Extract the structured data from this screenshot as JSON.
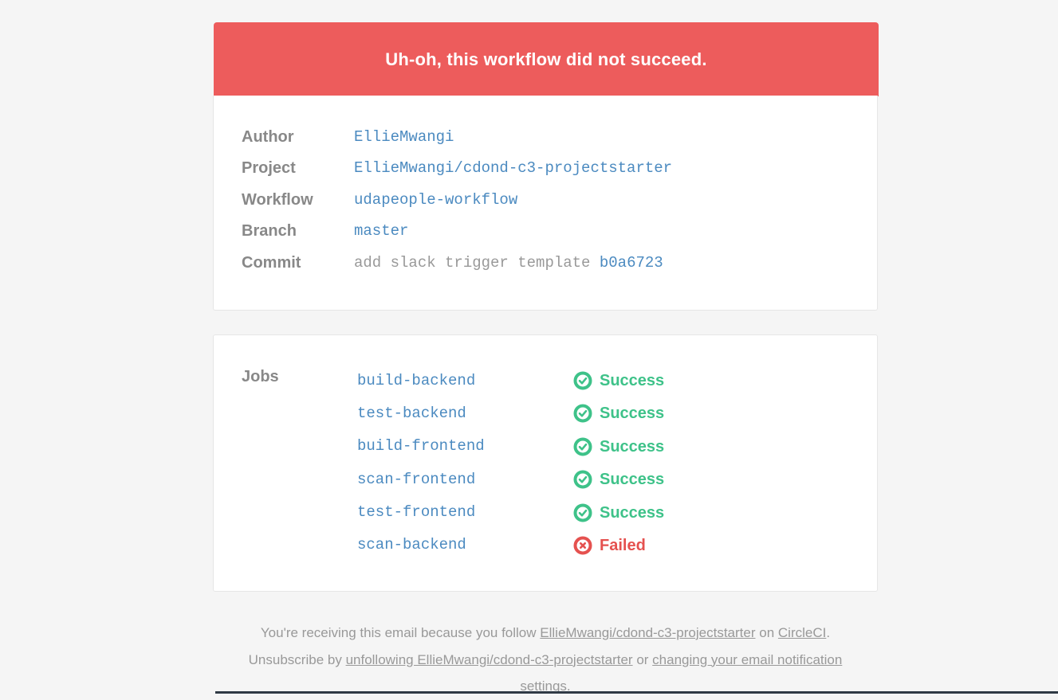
{
  "banner": {
    "title": "Uh-oh, this workflow did not succeed."
  },
  "details": {
    "author_label": "Author",
    "author_value": "EllieMwangi",
    "project_label": "Project",
    "project_value": "EllieMwangi/cdond-c3-projectstarter",
    "workflow_label": "Workflow",
    "workflow_value": "udapeople-workflow",
    "branch_label": "Branch",
    "branch_value": "master",
    "commit_label": "Commit",
    "commit_message": "add slack trigger template",
    "commit_hash": "b0a6723"
  },
  "jobs": {
    "label": "Jobs",
    "items": [
      {
        "name": "build-backend",
        "status": "Success"
      },
      {
        "name": "test-backend",
        "status": "Success"
      },
      {
        "name": "build-frontend",
        "status": "Success"
      },
      {
        "name": "scan-frontend",
        "status": "Success"
      },
      {
        "name": "test-frontend",
        "status": "Success"
      },
      {
        "name": "scan-backend",
        "status": "Failed"
      }
    ]
  },
  "footer": {
    "line1_prefix": "You're receiving this email because you follow",
    "line1_link": "EllieMwangi/cdond-c3-projectstarter",
    "line1_mid": "on",
    "line1_link2": "CircleCI",
    "line1_suffix": ".",
    "line2_prefix": "Unsubscribe by",
    "line2_link": "unfollowing EllieMwangi/cdond-c3-projectstarter",
    "line2_mid": "or",
    "line2_link2": "changing your email notification settings",
    "line2_suffix": "."
  },
  "colors": {
    "banner": "#ed5c5c",
    "link": "#4b8ac0",
    "success": "#3ec289",
    "failed": "#e5514f"
  }
}
